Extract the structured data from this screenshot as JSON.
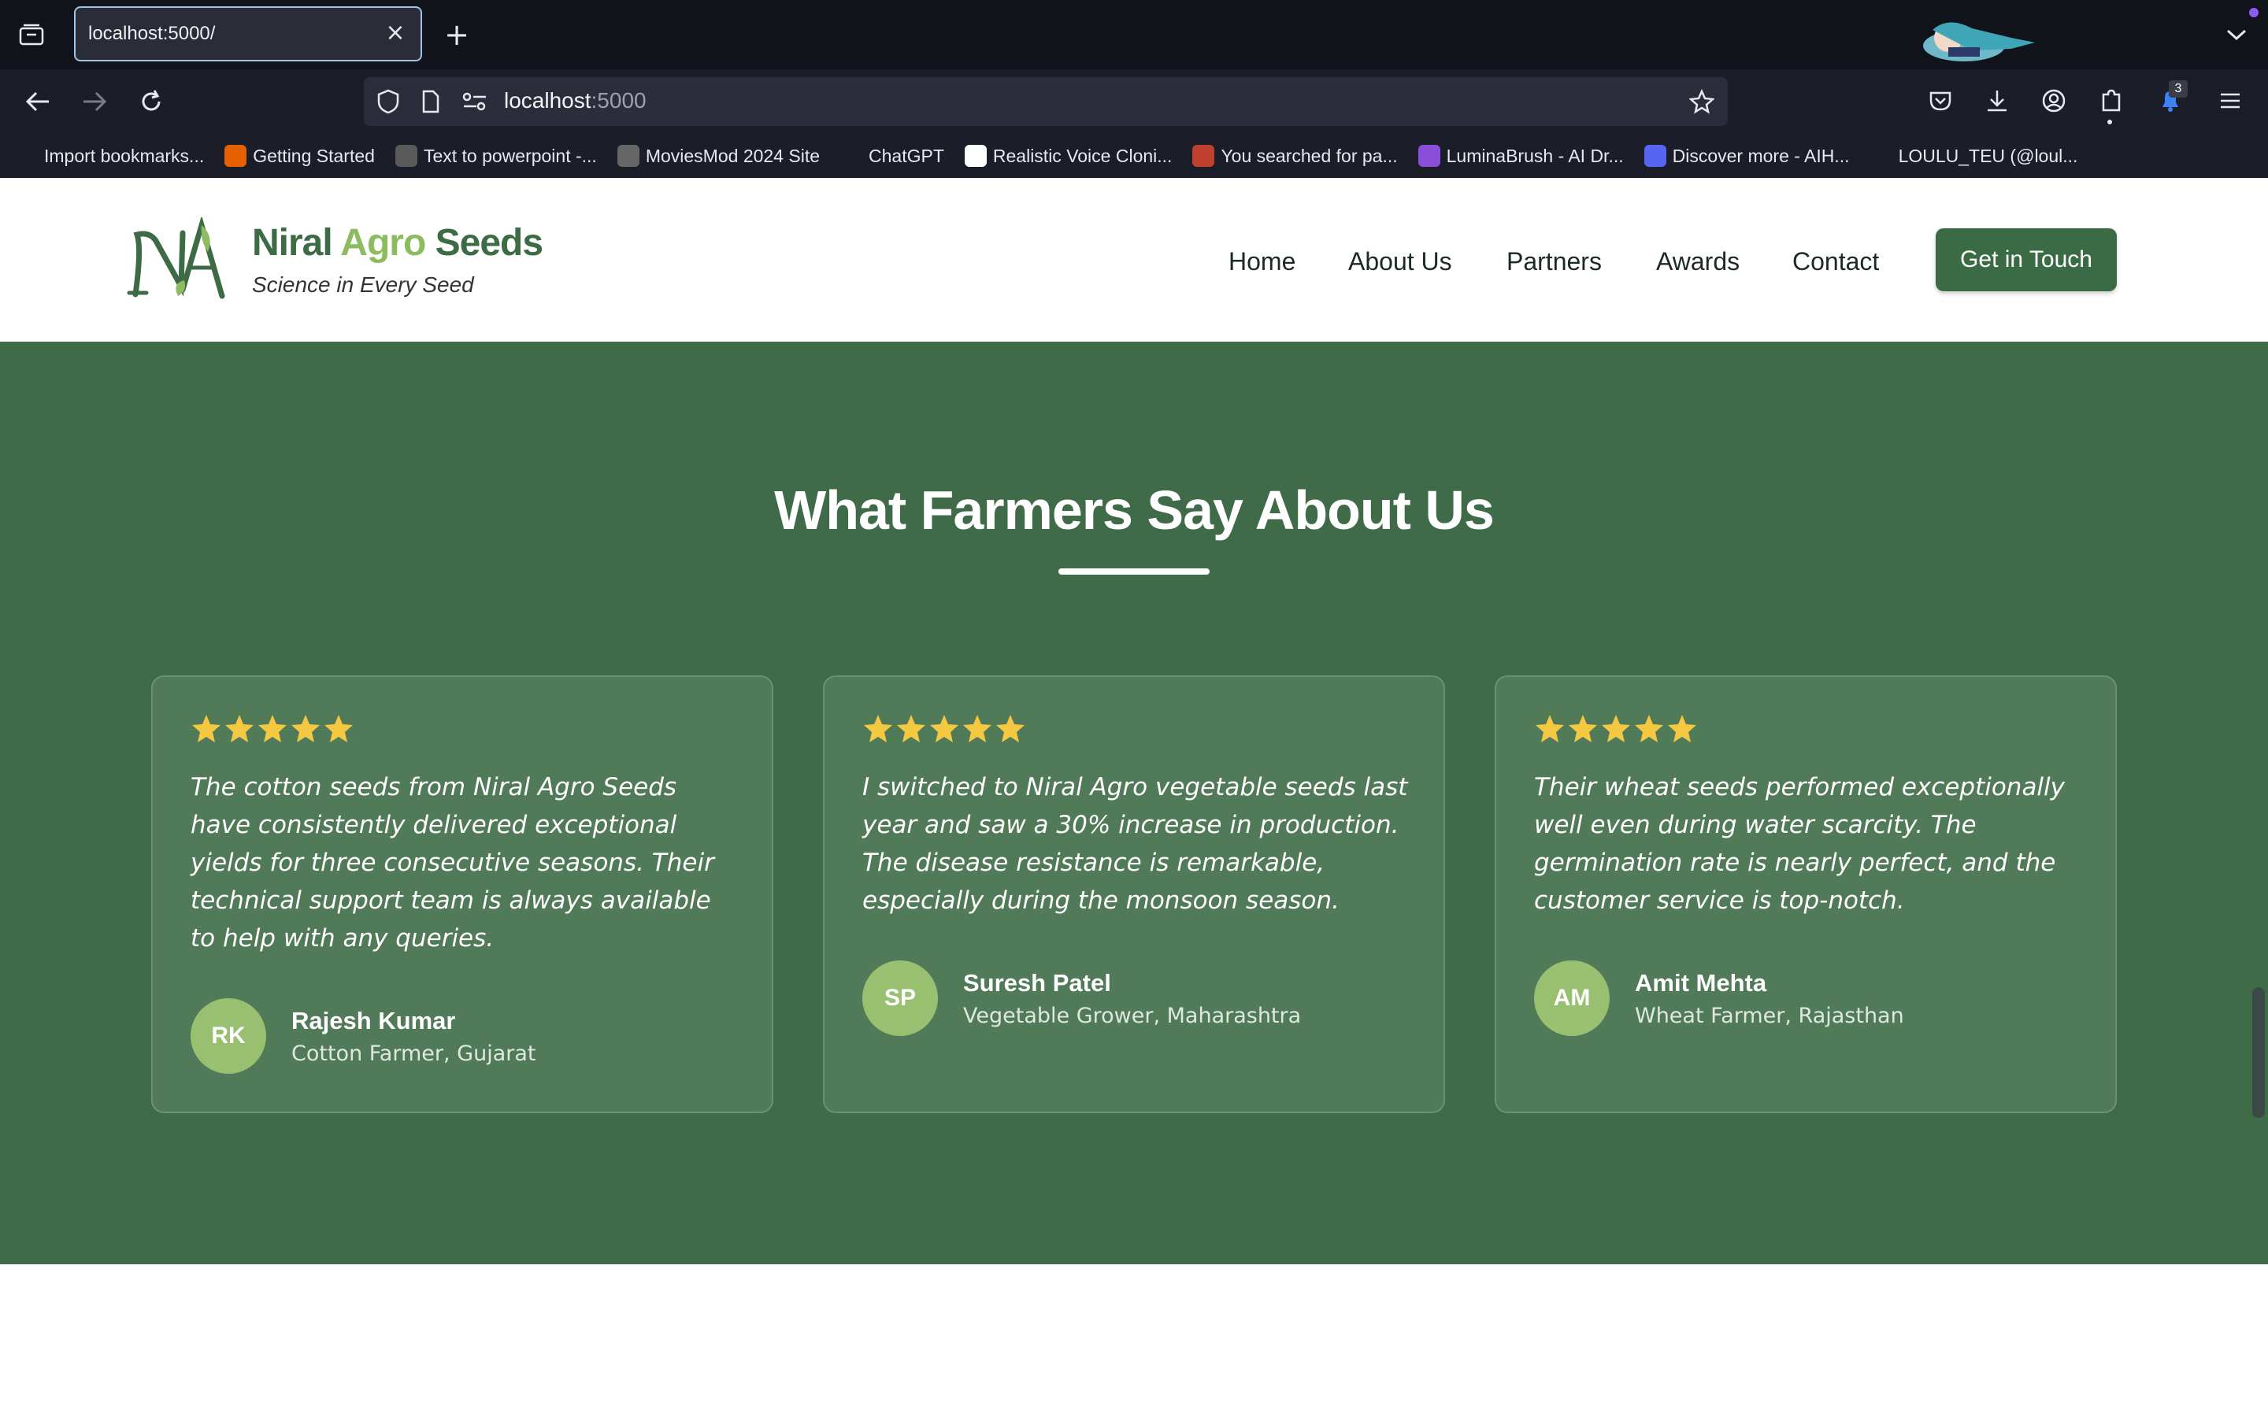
{
  "browser": {
    "tab_title": "localhost:5000/",
    "url_host": "localhost",
    "url_port": ":5000",
    "badge_count": "3",
    "bookmarks": [
      {
        "label": "Import bookmarks...",
        "icon": "import-icon",
        "color": "#1b1e28"
      },
      {
        "label": "Getting Started",
        "icon": "firefox-icon",
        "color": "#e66000"
      },
      {
        "label": "Text to powerpoint -...",
        "icon": "arm-icon",
        "color": "#5a5a5a"
      },
      {
        "label": "MoviesMod 2024 Site",
        "icon": "film-icon",
        "color": "#666666"
      },
      {
        "label": "ChatGPT",
        "icon": "chatgpt-icon",
        "color": "#1b1e28"
      },
      {
        "label": "Realistic Voice Cloni...",
        "icon": "g-logo-icon",
        "color": "#ffffff"
      },
      {
        "label": "You searched for pa...",
        "icon": "image-icon",
        "color": "#c04030"
      },
      {
        "label": "LuminaBrush - AI Dr...",
        "icon": "brush-icon",
        "color": "#8a4fd8"
      },
      {
        "label": "Discover more - AIH...",
        "icon": "discord-icon",
        "color": "#5865f2"
      },
      {
        "label": "LOULU_TEU (@loul...",
        "icon": "globe-icon",
        "color": "#1b1e28"
      }
    ]
  },
  "site": {
    "brand_part1": "Niral",
    "brand_part2": "Agro",
    "brand_part3": "Seeds",
    "tagline": "Science in Every Seed",
    "nav": [
      "Home",
      "About Us",
      "Partners",
      "Awards",
      "Contact"
    ],
    "cta": "Get in Touch"
  },
  "testimonials": {
    "title": "What Farmers Say About Us",
    "colors": {
      "section_bg": "#3f6b48",
      "card_bg": "#507a58",
      "star": "#f5c842",
      "avatar": "#98c070"
    },
    "items": [
      {
        "rating": 5,
        "quote": "The cotton seeds from Niral Agro Seeds have consistently delivered exceptional yields for three consecutive seasons. Their technical support team is always available to help with any queries.",
        "initials": "RK",
        "name": "Rajesh Kumar",
        "role": "Cotton Farmer, Gujarat"
      },
      {
        "rating": 5,
        "quote": "I switched to Niral Agro vegetable seeds last year and saw a 30% increase in production. The disease resistance is remarkable, especially during the monsoon season.",
        "initials": "SP",
        "name": "Suresh Patel",
        "role": "Vegetable Grower, Maharashtra"
      },
      {
        "rating": 5,
        "quote": "Their wheat seeds performed exceptionally well even during water scarcity. The germination rate is nearly perfect, and the customer service is top-notch.",
        "initials": "AM",
        "name": "Amit Mehta",
        "role": "Wheat Farmer, Rajasthan"
      }
    ]
  }
}
